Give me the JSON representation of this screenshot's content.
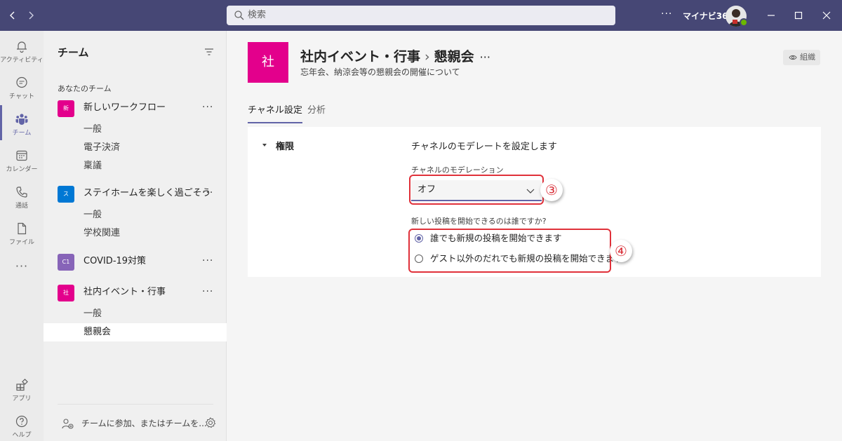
{
  "titlebar": {
    "search_placeholder": "検索",
    "more": "···",
    "org_name": "マイナビ365",
    "back_icon": "chevron-left-icon",
    "forward_icon": "chevron-right-icon"
  },
  "rail": {
    "items": [
      {
        "label": "アクティビティ",
        "icon": "bell-icon"
      },
      {
        "label": "チャット",
        "icon": "chat-icon"
      },
      {
        "label": "チーム",
        "icon": "teams-icon"
      },
      {
        "label": "カレンダー",
        "icon": "calendar-icon"
      },
      {
        "label": "通話",
        "icon": "phone-icon"
      },
      {
        "label": "ファイル",
        "icon": "file-icon"
      }
    ],
    "more": "···",
    "apps_label": "アプリ",
    "help_label": "ヘルプ"
  },
  "teams_pane": {
    "title": "チーム",
    "section_label": "あなたのチーム",
    "teams": [
      {
        "tile": "新",
        "tile_color": "#e3008c",
        "name": "新しいワークフロー",
        "channels": [
          "一般",
          "電子決済",
          "稟議"
        ]
      },
      {
        "tile": "ス",
        "tile_color": "#0078d4",
        "name": "ステイホームを楽しく過ごそう",
        "channels": [
          "一般",
          "学校関連"
        ]
      },
      {
        "tile": "C1",
        "tile_color": "#8764b8",
        "name": "COVID-19対策",
        "channels": []
      },
      {
        "tile": "社",
        "tile_color": "#e3008c",
        "name": "社内イベント・行事",
        "channels": [
          "一般",
          "懇親会"
        ]
      }
    ],
    "team_more": "···",
    "join_label": "チームに参加、またはチームを..."
  },
  "channel_header": {
    "avatar_text": "社",
    "team": "社内イベント・行事",
    "separator": "›",
    "channel": "懇親会",
    "more": "···",
    "description": "忘年会、納涼会等の懇親会の開催について",
    "org_button": "組織",
    "accent": "#6264a7"
  },
  "tabs": [
    "チャネル設定",
    "分析"
  ],
  "settings": {
    "section": "権限",
    "heading": "チャネルのモデレートを設定します",
    "moderation_label": "チャネルのモデレーション",
    "moderation_value": "オフ",
    "post_label": "新しい投稿を開始できるのは誰ですか?",
    "options": [
      "誰でも新規の投稿を開始できます",
      "ゲスト以外のだれでも新規の投稿を開始できます"
    ],
    "selected_option": 0
  },
  "annotations": {
    "callout_3": "③",
    "callout_4": "④",
    "highlight_color": "#e0313a"
  }
}
